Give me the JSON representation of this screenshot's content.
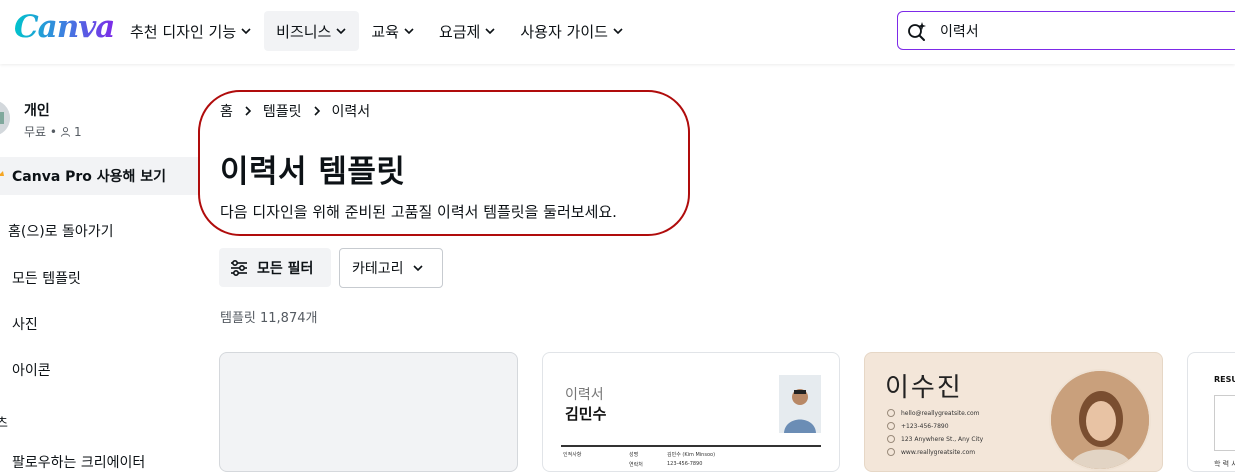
{
  "header": {
    "logo": "Canva",
    "nav": [
      {
        "label": "추천 디자인 기능"
      },
      {
        "label": "비즈니스"
      },
      {
        "label": "교육"
      },
      {
        "label": "요금제"
      },
      {
        "label": "사용자 가이드"
      }
    ],
    "search_value": "이력서"
  },
  "sidebar": {
    "profile_name": "개인",
    "profile_plan": "무료 •",
    "profile_members": "1",
    "pro_label": "Canva Pro 사용해 보기",
    "links": [
      "홈(으)로 돌아가기",
      "모든 템플릿",
      "사진",
      "아이콘"
    ],
    "section_label": "츠",
    "section_link": "팔로우하는 크리에이터"
  },
  "main": {
    "breadcrumb": [
      "홈",
      "템플릿",
      "이력서"
    ],
    "title": "이력서 템플릿",
    "subtitle": "다음 디자인을 위해 준비된 고품질 이력서 템플릿을 둘러보세요.",
    "filter_label": "모든 필터",
    "category_label": "카테고리",
    "result_count": "템플릿 11,874개"
  },
  "cards": {
    "card2": {
      "label": "이력서",
      "name": "김민수",
      "rows": [
        {
          "k": "인적사항",
          "a": "성명",
          "b": "김민수 (Kim Minsoo)"
        },
        {
          "k": "",
          "a": "연락처",
          "b": "123-456-7890"
        }
      ]
    },
    "card3": {
      "name": "이수진",
      "contacts": [
        "hello@reallygreatsite.com",
        "+123-456-7890",
        "123 Anywhere St., Any City",
        "www.reallygreatsite.com"
      ]
    },
    "card4": {
      "title": "RESU",
      "foot": "학 력 사"
    }
  },
  "colors": {
    "accent": "#7d2ae8",
    "highlight": "#b00c0c",
    "active_bg": "#f2f3f5"
  }
}
